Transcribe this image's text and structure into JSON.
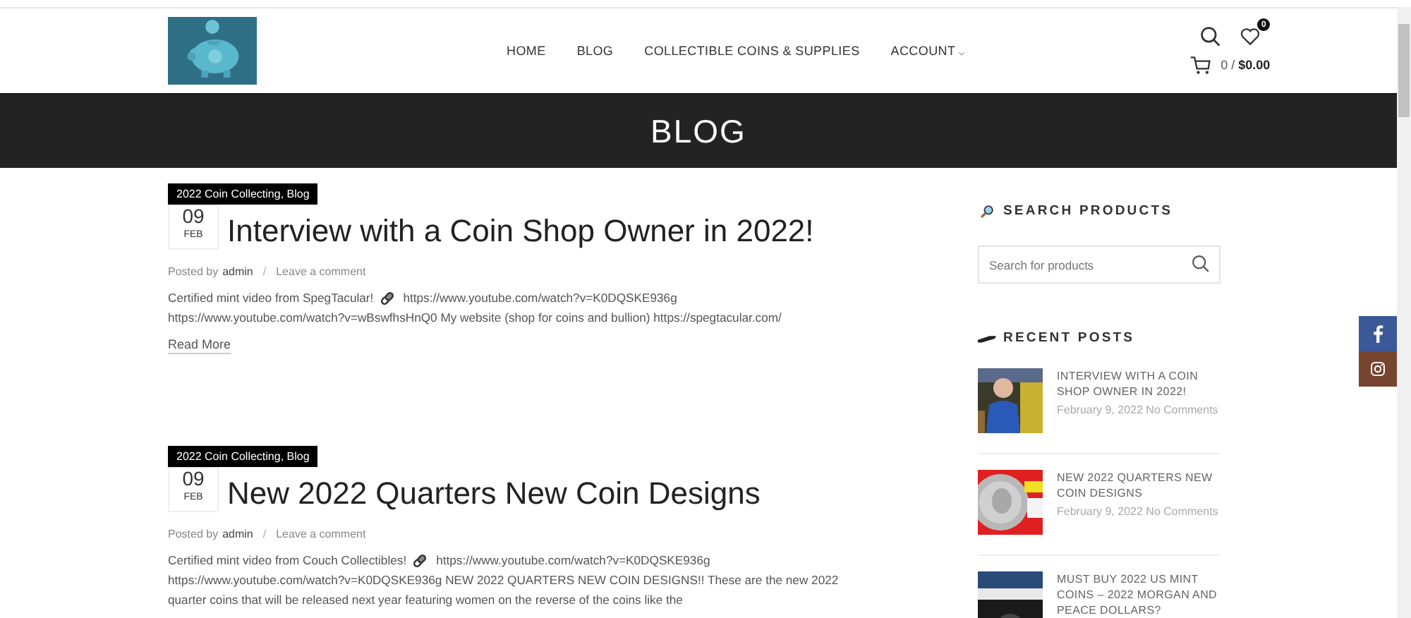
{
  "header": {
    "nav": [
      {
        "label": "HOME",
        "kind": "link"
      },
      {
        "label": "BLOG",
        "kind": "link"
      },
      {
        "label": "COLLECTIBLE COINS & SUPPLIES",
        "kind": "link"
      },
      {
        "label": "ACCOUNT",
        "kind": "dropdown"
      }
    ],
    "wishlist_count": "0",
    "cart": "0 / **$0.00**"
  },
  "page_title": "BLOG",
  "posts": [
    {
      "category": "2022 Coin Collecting, Blog",
      "day": "09",
      "month": "FEB",
      "title": "Interview with a Coin Shop Owner in 2022!",
      "posted_by": "Posted by",
      "author": "admin",
      "separator": "/",
      "comment_link": "Leave a comment",
      "excerpt_lines": [
        [
          "Certified mint video from SpegTacular!",
          "https://www.youtube.com/watch?v=K0DQSKE936g"
        ],
        [
          "https://www.youtube.com/watch?v=wBswfhsHnQ0   My website (shop for coins and bullion) https://spegtacular.com/"
        ]
      ],
      "read_more": "Read More"
    },
    {
      "category": "2022 Coin Collecting, Blog",
      "day": "09",
      "month": "FEB",
      "title": "New 2022 Quarters New Coin Designs",
      "posted_by": "Posted by",
      "author": "admin",
      "separator": "/",
      "comment_link": "Leave a comment",
      "excerpt_lines": [
        [
          "Certified mint video from Couch Collectibles!",
          "https://www.youtube.com/watch?v=K0DQSKE936g"
        ],
        [
          "https://www.youtube.com/watch?v=K0DQSKE936g   NEW 2022 QUARTERS NEW COIN DESIGNS!! These are the new 2022"
        ],
        [
          "quarter coins that will be released next year featuring women on the reverse of the coins like the"
        ]
      ]
    }
  ],
  "sidebar": {
    "search_heading": "SEARCH PRODUCTS",
    "search_placeholder": "Search for products",
    "recent_heading": "RECENT POSTS",
    "recent_posts": [
      {
        "title": "INTERVIEW WITH A COIN SHOP OWNER IN 2022!",
        "date": "February 9, 2022",
        "comments": "No Comments"
      },
      {
        "title": "NEW 2022 QUARTERS NEW COIN DESIGNS",
        "date": "February 9, 2022",
        "comments": "No Comments"
      },
      {
        "title": "MUST BUY 2022 US MINT COINS – 2022 MORGAN AND PEACE DOLLARS?"
      }
    ]
  },
  "social": [
    {
      "kind": "facebook"
    },
    {
      "kind": "instagram"
    }
  ]
}
